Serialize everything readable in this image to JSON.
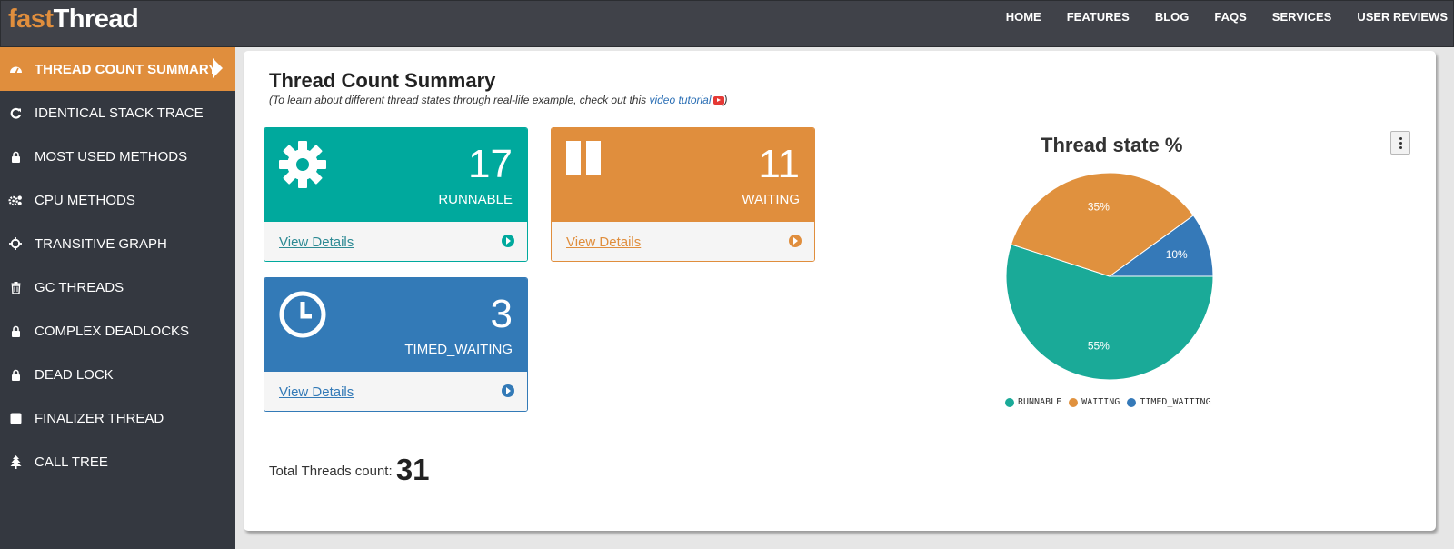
{
  "app": {
    "logo_part1": "fast",
    "logo_part2": "Thread"
  },
  "nav": [
    "HOME",
    "FEATURES",
    "BLOG",
    "FAQS",
    "SERVICES",
    "USER REVIEWS"
  ],
  "sidebar": {
    "items": [
      {
        "label": "THREAD COUNT SUMMARY",
        "icon": "dashboard-icon",
        "active": true
      },
      {
        "label": "IDENTICAL STACK TRACE",
        "icon": "refresh-icon"
      },
      {
        "label": "MOST USED METHODS",
        "icon": "lock-icon"
      },
      {
        "label": "CPU METHODS",
        "icon": "cogs-icon"
      },
      {
        "label": "TRANSITIVE GRAPH",
        "icon": "crosshair-icon"
      },
      {
        "label": "GC THREADS",
        "icon": "trash-icon"
      },
      {
        "label": "COMPLEX DEADLOCKS",
        "icon": "lock-icon"
      },
      {
        "label": "DEAD LOCK",
        "icon": "lock-icon"
      },
      {
        "label": "FINALIZER THREAD",
        "icon": "square-icon"
      },
      {
        "label": "CALL TREE",
        "icon": "tree-icon"
      }
    ]
  },
  "main": {
    "title": "Thread Count Summary",
    "subtitle_pre": "(To learn about different thread states through real-life example, check out this ",
    "subtitle_link": "video tutorial",
    "subtitle_post": ")",
    "cards": [
      {
        "count": "17",
        "state": "RUNNABLE",
        "link": "View Details",
        "icon": "gear-icon",
        "color": "#00a99d",
        "link_color": "#2d8a94"
      },
      {
        "count": "11",
        "state": "WAITING",
        "link": "View Details",
        "icon": "pause-icon",
        "color": "#e08e3d",
        "link_color": "#e08e3d"
      },
      {
        "count": "3",
        "state": "TIMED_WAITING",
        "link": "View Details",
        "icon": "clock-icon",
        "color": "#337ab7",
        "link_color": "#337ab7"
      }
    ],
    "total_label": "Total Threads count:",
    "total_value": "31"
  },
  "chart_data": {
    "type": "pie",
    "title": "Thread state %",
    "series": [
      {
        "name": "RUNNABLE",
        "value": 55,
        "label": "55%",
        "color": "#1aaa98"
      },
      {
        "name": "WAITING",
        "value": 35,
        "label": "35%",
        "color": "#e0913e"
      },
      {
        "name": "TIMED_WAITING",
        "value": 10,
        "label": "10%",
        "color": "#3579b8"
      }
    ],
    "legend_position": "bottom"
  }
}
